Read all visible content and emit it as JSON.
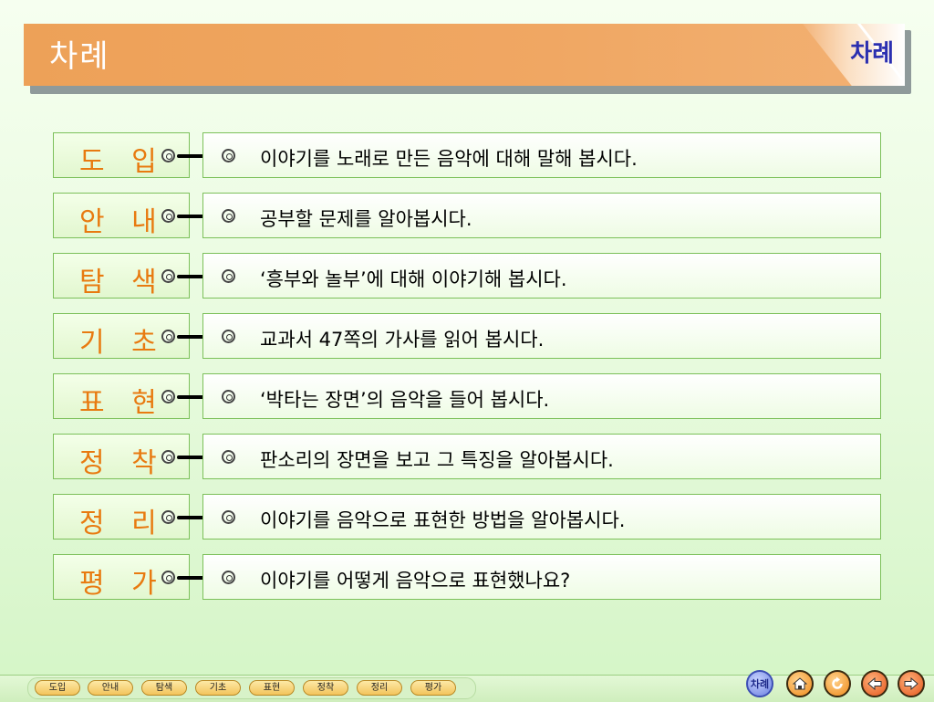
{
  "header": {
    "title": "차례",
    "corner_label": "차례"
  },
  "rows": [
    {
      "label": "도 입",
      "text": "이야기를 노래로 만든 음악에 대해 말해 봅시다."
    },
    {
      "label": "안 내",
      "text": "공부할 문제를  알아봅시다."
    },
    {
      "label": "탐 색",
      "text": "‘흥부와 놀부’에 대해  이야기해 봅시다."
    },
    {
      "label": "기 초",
      "text": "교과서 47쪽의 가사를 읽어 봅시다."
    },
    {
      "label": "표 현",
      "text": "‘박타는 장면’의 음악을 들어 봅시다."
    },
    {
      "label": "정 착",
      "text": "판소리의  장면을 보고 그 특징을  알아봅시다."
    },
    {
      "label": "정 리",
      "text": "이야기를 음악으로 표현한 방법을  알아봅시다."
    },
    {
      "label": "평 가",
      "text": "이야기를 어떻게 음악으로 표현했나요?"
    }
  ],
  "bottom_nav": {
    "items": [
      "도입",
      "안내",
      "탐색",
      "기초",
      "표현",
      "정착",
      "정리",
      "평가"
    ],
    "toc_label": "차례",
    "icons": [
      "toc-icon",
      "home-icon",
      "reload-icon",
      "prev-arrow-icon",
      "next-arrow-icon"
    ]
  },
  "colors": {
    "header": "#f0a763",
    "label": "#e87a10",
    "border": "#7cc05a",
    "corner_text": "#2b2fb0"
  }
}
